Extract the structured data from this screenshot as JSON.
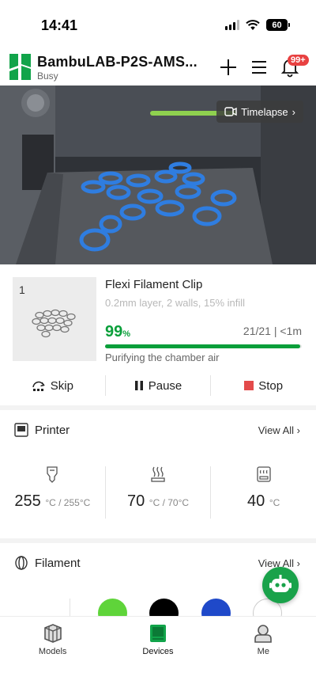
{
  "status_bar": {
    "time": "14:41",
    "battery": "60"
  },
  "header": {
    "device_name": "BambuLAB-P2S-AMS...",
    "device_status": "Busy",
    "notification_badge": "99+",
    "icons": [
      "add-icon",
      "menu-icon",
      "bell-icon"
    ],
    "accent_color": "#0a9f3a"
  },
  "camera": {
    "timelapse_label": "Timelapse"
  },
  "job": {
    "plate_number": "1",
    "title": "Flexi Filament Clip",
    "subtitle": "0.2mm layer, 2 walls, 15% infill",
    "progress_value": "99",
    "progress_unit": "%",
    "progress_fraction": 0.99,
    "layers": "21/21",
    "remaining": "<1m",
    "stage": "Purifying the chamber air",
    "actions": {
      "skip": "Skip",
      "pause": "Pause",
      "stop": "Stop"
    }
  },
  "printer": {
    "title": "Printer",
    "view_all": "View All",
    "temps": [
      {
        "icon": "nozzle-icon",
        "value": "255",
        "unit": "°C / 255°C"
      },
      {
        "icon": "heatbed-icon",
        "value": "70",
        "unit": "°C / 70°C"
      },
      {
        "icon": "chamber-icon",
        "value": "40",
        "unit": "°C"
      }
    ]
  },
  "filament": {
    "title": "Filament",
    "view_all": "View All",
    "colors": [
      "#5fd43a",
      "#000000",
      "#1f49c9",
      "#ffffff"
    ]
  },
  "nav": {
    "items": [
      {
        "label": "Models",
        "icon": "models-icon"
      },
      {
        "label": "Devices",
        "icon": "devices-icon"
      },
      {
        "label": "Me",
        "icon": "profile-icon"
      }
    ],
    "active": "Devices"
  }
}
